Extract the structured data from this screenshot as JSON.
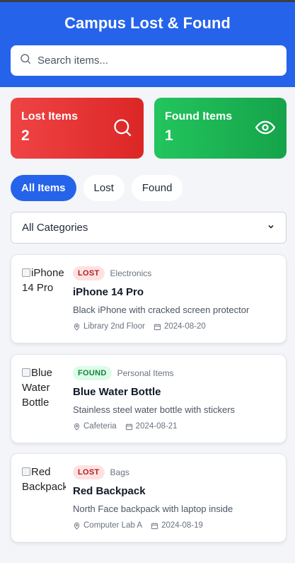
{
  "app": {
    "title": "Campus Lost & Found"
  },
  "search": {
    "placeholder": "Search items..."
  },
  "stats": {
    "lost": {
      "label": "Lost Items",
      "value": "2"
    },
    "found": {
      "label": "Found Items",
      "value": "1"
    }
  },
  "filters": [
    "All Items",
    "Lost",
    "Found"
  ],
  "category_select": {
    "selected": "All Categories"
  },
  "items": [
    {
      "image_alt": "iPhone 14 Pro",
      "status": "LOST",
      "category": "Electronics",
      "name": "iPhone 14 Pro",
      "description": "Black iPhone with cracked screen protector",
      "location": "Library 2nd Floor",
      "date": "2024-08-20"
    },
    {
      "image_alt": "Blue Water Bottle",
      "status": "FOUND",
      "category": "Personal Items",
      "name": "Blue Water Bottle",
      "description": "Stainless steel water bottle with stickers",
      "location": "Cafeteria",
      "date": "2024-08-21"
    },
    {
      "image_alt": "Red Backpack",
      "status": "LOST",
      "category": "Bags",
      "name": "Red Backpack",
      "description": "North Face backpack with laptop inside",
      "location": "Computer Lab A",
      "date": "2024-08-19"
    }
  ],
  "colors": {
    "primary": "#2563eb",
    "lost": "#ef4444",
    "found": "#22c55e"
  }
}
